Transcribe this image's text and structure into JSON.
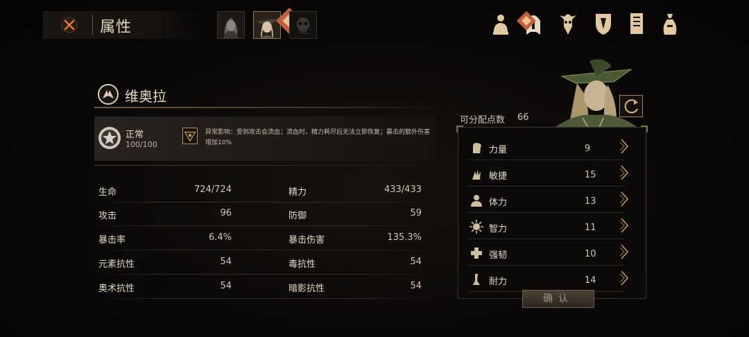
{
  "header": {
    "title": "属性",
    "close_icon": "close-x-icon",
    "party": [
      {
        "name": "portrait-character-1",
        "active": false
      },
      {
        "name": "portrait-character-2",
        "active": true
      },
      {
        "name": "portrait-character-3",
        "active": false
      }
    ],
    "menu_icons": [
      "character-bust-icon",
      "helmet-icon",
      "skill-tree-icon",
      "shield-icon",
      "journal-icon",
      "bag-icon"
    ]
  },
  "character": {
    "name": "维奥拉",
    "status": {
      "label": "正常",
      "value": "100/100",
      "effect_text": "异常影响：受到攻击会流血；流血时，精力耗尽后无法立即恢复；暴击的额外伤害增加10%"
    }
  },
  "stats": [
    {
      "label1": "生命",
      "value1": "724/724",
      "label2": "精力",
      "value2": "433/433"
    },
    {
      "label1": "攻击",
      "value1": "96",
      "label2": "防御",
      "value2": "59"
    },
    {
      "label1": "暴击率",
      "value1": "6.4%",
      "label2": "暴击伤害",
      "value2": "135.3%"
    },
    {
      "label1": "元素抗性",
      "value1": "54",
      "label2": "毒抗性",
      "value2": "54"
    },
    {
      "label1": "奥术抗性",
      "value1": "54",
      "label2": "暗影抗性",
      "value2": "54"
    }
  ],
  "attributes": {
    "points_label": "可分配点数",
    "points_value": "66",
    "items": [
      {
        "label": "力量",
        "value": "9",
        "icon": "fist-icon"
      },
      {
        "label": "敏捷",
        "value": "15",
        "icon": "hand-icon"
      },
      {
        "label": "体力",
        "value": "13",
        "icon": "body-icon"
      },
      {
        "label": "智力",
        "value": "11",
        "icon": "sun-mind-icon"
      },
      {
        "label": "强韧",
        "value": "10",
        "icon": "cross-icon"
      },
      {
        "label": "耐力",
        "value": "14",
        "icon": "leg-icon"
      }
    ],
    "confirm_label": "确认"
  },
  "colors": {
    "accent": "#c59a55",
    "badge": "#c0603a",
    "text": "#e2d8c6"
  }
}
